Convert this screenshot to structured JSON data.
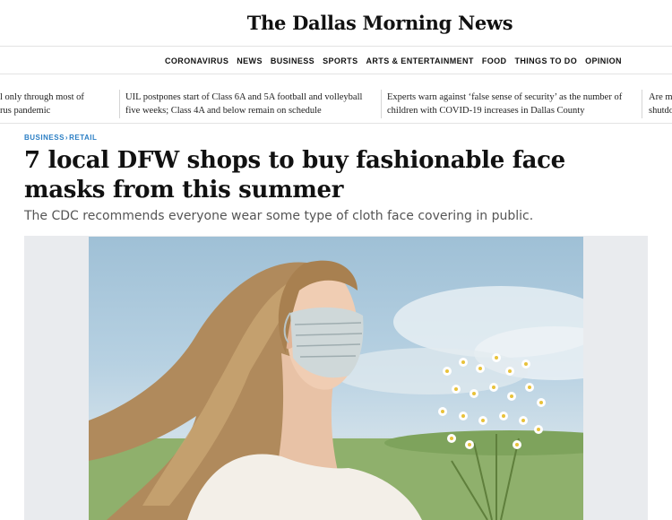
{
  "masthead": {
    "logo": "The Dallas Morning News"
  },
  "nav": {
    "items": [
      "CORONAVIRUS",
      "NEWS",
      "BUSINESS",
      "SPORTS",
      "ARTS & ENTERTAINMENT",
      "FOOD",
      "THINGS TO DO",
      "OPINION"
    ]
  },
  "ticker": {
    "items": [
      {
        "line1": "l only through most of",
        "line2": "rus pandemic"
      },
      {
        "line1": "UIL postpones start of Class 6A and 5A football and volleyball",
        "line2": "five weeks; Class 4A and below remain on schedule"
      },
      {
        "line1": "Experts warn against ‘false sense of security’ as the number of",
        "line2": "children with COVID-19 increases in Dallas County"
      },
      {
        "line1": "Are m",
        "line2": "shutdo"
      }
    ]
  },
  "article": {
    "section": "BUSINESS",
    "subsection": "RETAIL",
    "separator": "›",
    "headline_line1": "7 local DFW shops to buy fashionable face",
    "headline_line2": "masks from this summer",
    "subhead": "The CDC recommends everyone wear some type of cloth face covering in public."
  },
  "colors": {
    "accent": "#2a7ec4",
    "text": "#111111",
    "subtle": "#555555",
    "frame": "#e9ebee"
  }
}
